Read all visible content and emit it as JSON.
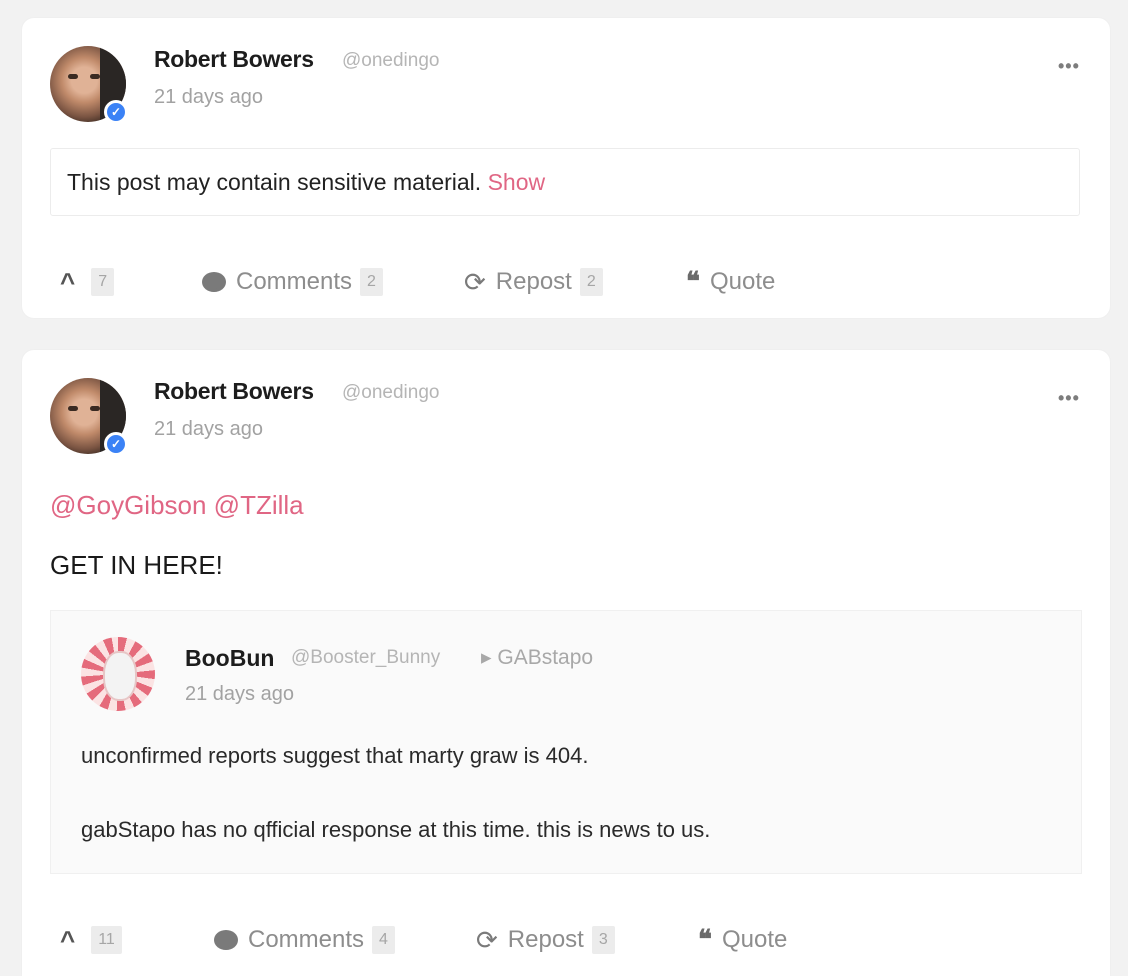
{
  "posts": [
    {
      "author": "Robert Bowers",
      "handle": "@onedingo",
      "time": "21 days ago",
      "more": "•••",
      "sensitive_text": "This post may contain sensitive material. ",
      "show_label": "Show",
      "actions": {
        "upvotes": "7",
        "comments_label": "Comments",
        "comments_count": "2",
        "repost_label": "Repost",
        "repost_count": "2",
        "quote_label": "Quote"
      }
    },
    {
      "author": "Robert Bowers",
      "handle": "@onedingo",
      "time": "21 days ago",
      "more": "•••",
      "mentions": "@GoyGibson @TZilla",
      "body": "GET IN HERE!",
      "quoted": {
        "author": "BooBun",
        "handle": "@Booster_Bunny",
        "group": "▸ GABstapo",
        "time": "21 days ago",
        "line1": "unconfirmed reports suggest that marty graw is 404.",
        "line2": "gabStapo has no qfficial response at this time. this is news to us."
      },
      "actions": {
        "upvotes": "11",
        "comments_label": "Comments",
        "comments_count": "4",
        "repost_label": "Repost",
        "repost_count": "3",
        "quote_label": "Quote"
      }
    }
  ],
  "icons": {
    "upvote": "chevron-up-icon",
    "comment": "comment-bubble-icon",
    "repost": "repost-icon",
    "quote": "quote-icon",
    "verified": "verified-check-icon"
  },
  "colors": {
    "accent": "#e06684",
    "verified": "#3b82f6"
  }
}
